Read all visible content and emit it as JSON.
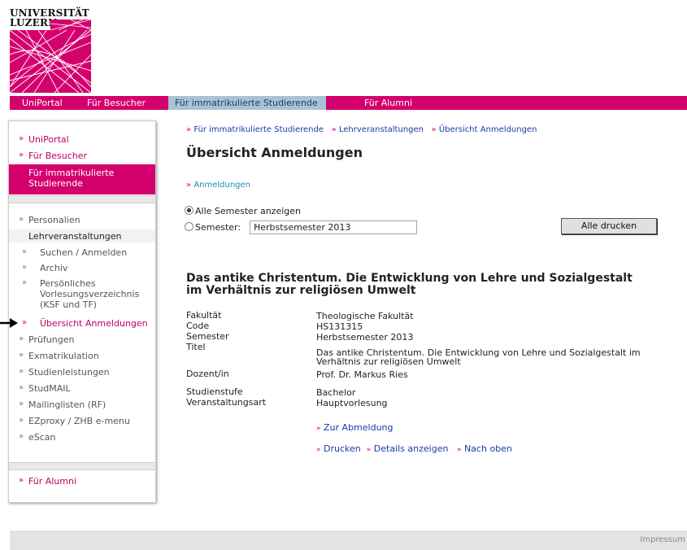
{
  "logo": {
    "line1": "UNIVERSITÄT",
    "line2": "LUZERN"
  },
  "topnav": [
    "UniPortal",
    "Für Besucher",
    "Für immatrikulierte Studierende",
    "Für Alumni"
  ],
  "sidebar": {
    "top": [
      "UniPortal",
      "Für Besucher"
    ],
    "active": "Für immatrikulierte Studierende",
    "personalien": "Personalien",
    "lehrveranstaltungen": "Lehrveranstaltungen",
    "sub": [
      "Suchen / Anmelden",
      "Archiv",
      "Persönliches Vorlesungsverzeichnis (KSF und TF)",
      "Übersicht Anmeldungen"
    ],
    "rest": [
      "Prüfungen",
      "Exmatrikulation",
      "Studienleistungen",
      "StudMAIL",
      "Mailinglisten (RF)",
      "EZproxy / ZHB e-menu",
      "eScan"
    ],
    "alumni": "Für Alumni"
  },
  "breadcrumb": [
    "Für immatrikulierte Studierende",
    "Lehrveranstaltungen",
    "Übersicht Anmeldungen"
  ],
  "page_title": "Übersicht Anmeldungen",
  "anmeldungen_link": "Anmeldungen",
  "filter": {
    "all_label": "Alle Semester anzeigen",
    "semester_label": "Semester:",
    "semester_value": "Herbstsemester 2013",
    "print_all": "Alle drucken"
  },
  "course": {
    "title": "Das antike Christentum. Die Entwicklung von Lehre und Sozialgestalt im Verhältnis zur religiösen Umwelt",
    "labels": [
      "Fakultät",
      "Code",
      "Semester",
      "Titel",
      "Dozent/in",
      "Studienstufe",
      "Veranstaltungsart"
    ],
    "values": [
      "Theologische Fakultät",
      "HS131315",
      "Herbstsemester 2013",
      "Das antike Christentum. Die Entwicklung von Lehre und Sozialgestalt im Verhältnis zur religiösen Umwelt",
      "Prof. Dr. Markus Ries",
      "Bachelor",
      "Hauptvorlesung"
    ],
    "unsubscribe": "Zur Abmeldung",
    "actions": [
      "Drucken",
      "Details anzeigen",
      "Nach oben"
    ]
  },
  "footer": {
    "impressum": "Impressum"
  },
  "colors": {
    "brand": "#d4006e",
    "active_tab": "#a7c3d6",
    "link": "#1a3aa8"
  }
}
